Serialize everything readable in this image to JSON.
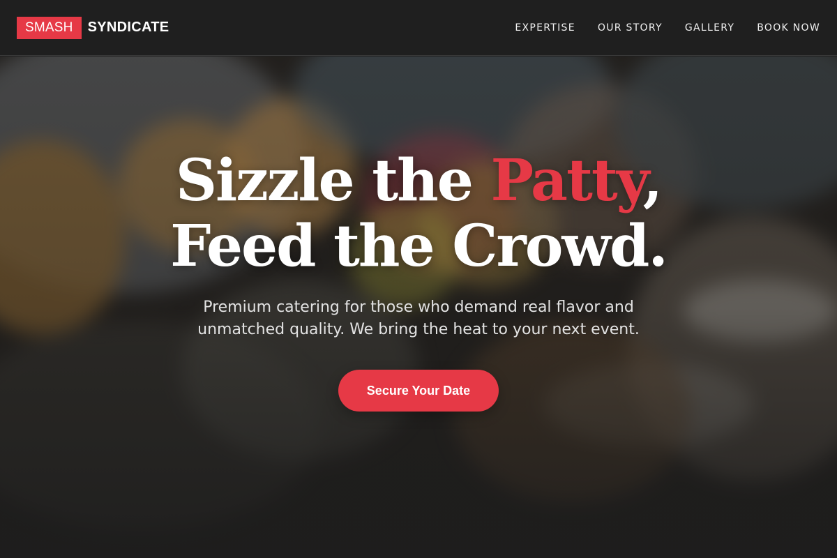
{
  "brand": {
    "badge": "SMASH",
    "name": "SYNDICATE",
    "accent_color": "#e63946"
  },
  "nav": {
    "items": [
      {
        "label": "EXPERTISE"
      },
      {
        "label": "OUR STORY"
      },
      {
        "label": "GALLERY"
      },
      {
        "label": "BOOK NOW"
      }
    ]
  },
  "hero": {
    "headline_part1": "Sizzle the ",
    "headline_accent": "Patty",
    "headline_part2": ",",
    "headline_line2": "Feed the Crowd.",
    "subtitle": "Premium catering for those who demand real flavor and unmatched quality. We bring the heat to your next event.",
    "cta_label": "Secure Your Date"
  }
}
